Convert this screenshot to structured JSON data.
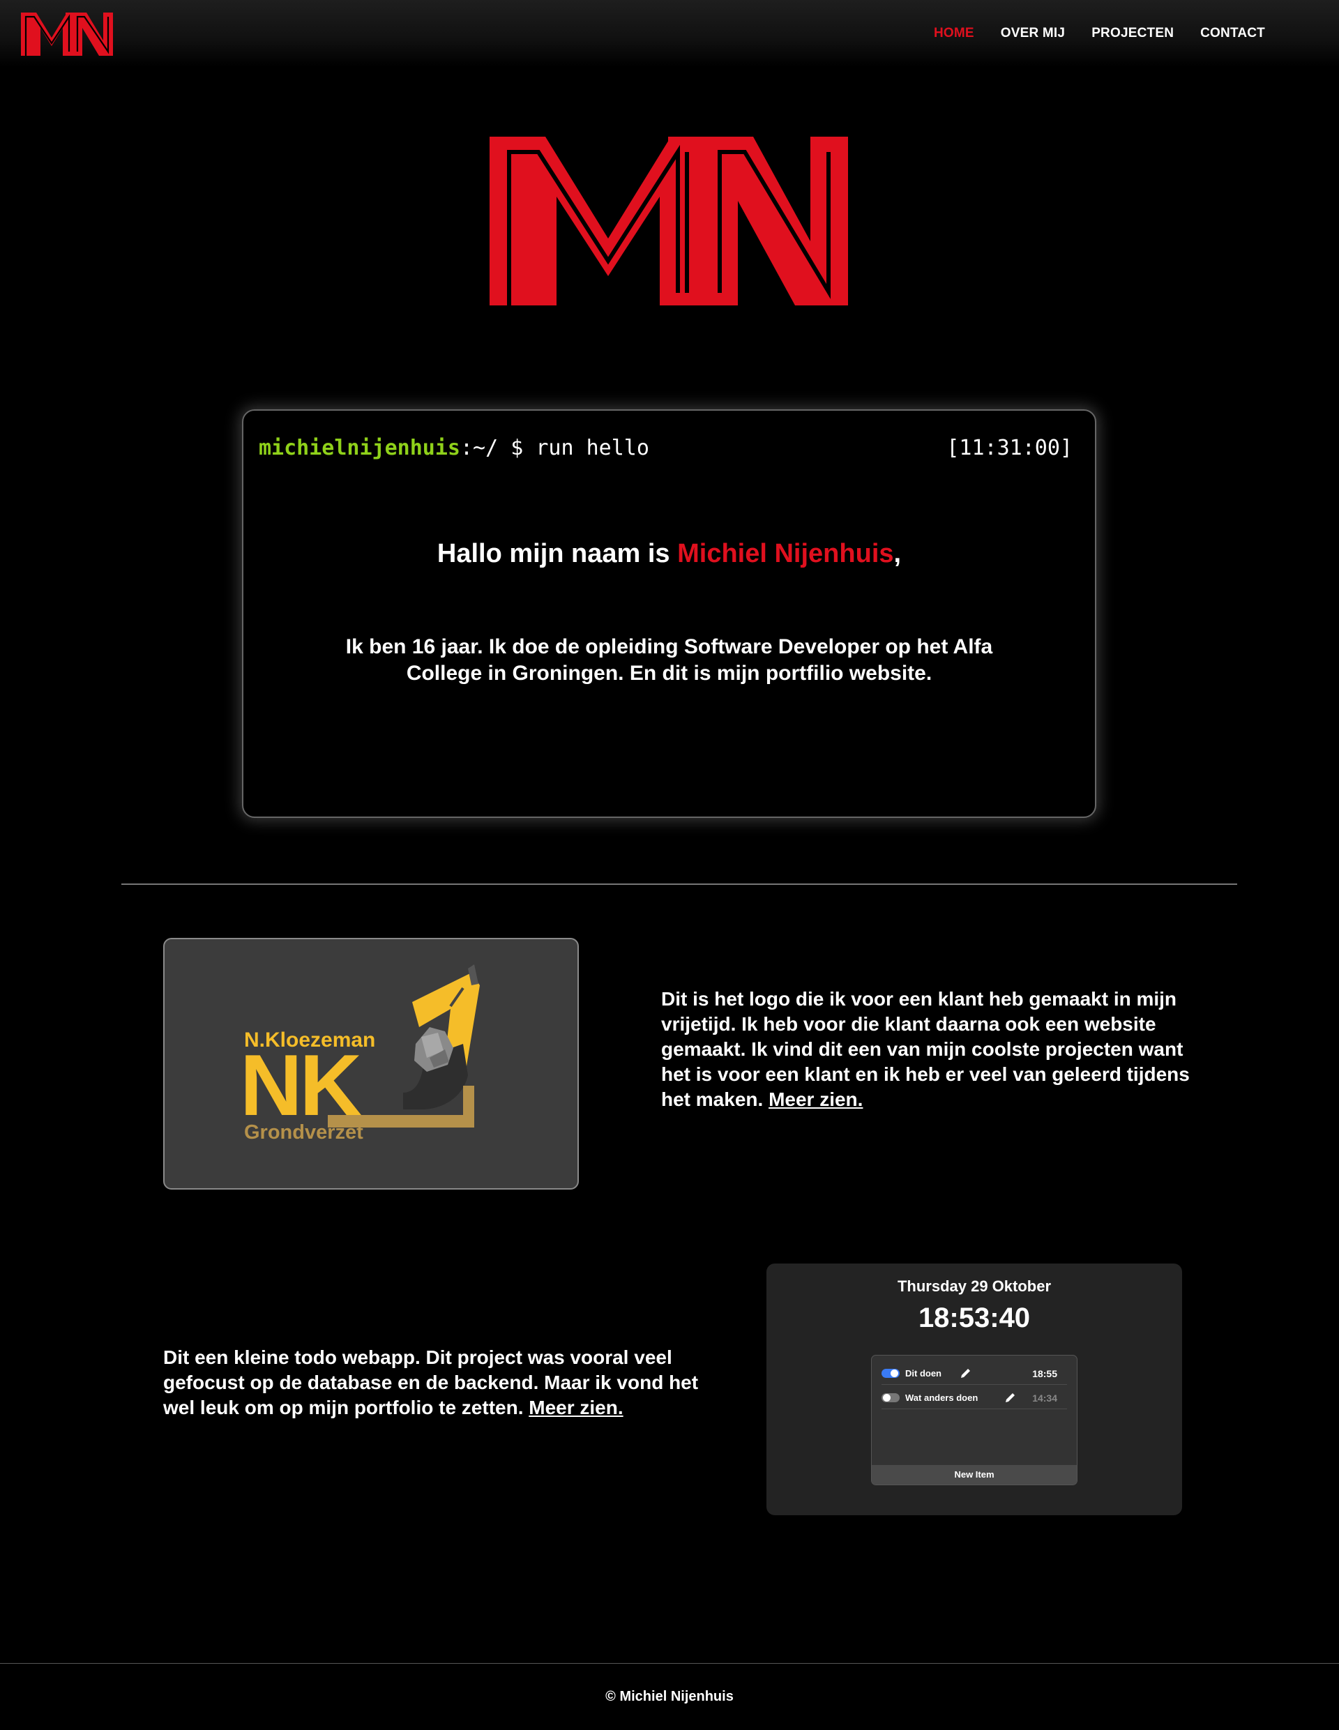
{
  "nav": {
    "logo_alt": "MN",
    "links": [
      {
        "label": "HOME",
        "active": true
      },
      {
        "label": "OVER MIJ",
        "active": false
      },
      {
        "label": "PROJECTEN",
        "active": false
      },
      {
        "label": "CONTACT",
        "active": false
      }
    ]
  },
  "colors": {
    "accent_red": "#e0101e",
    "prompt_green": "#8fd11a",
    "toggle_blue": "#3a7bf5",
    "nk_yellow": "#f5bd29",
    "nk_gold": "#b5914a"
  },
  "terminal": {
    "user": "michielnijenhuis",
    "path": ":~/",
    "command": " $ run hello",
    "time": "[11:31:00]",
    "greeting_prefix": "Hallo mijn naam is ",
    "greeting_name": "Michiel Nijenhuis",
    "greeting_suffix": ",",
    "intro": "Ik ben 16 jaar. Ik doe de opleiding Software Developer op het Alfa College in Groningen. En dit is mijn portfilio website."
  },
  "projects": {
    "p1": {
      "logo": {
        "brand_top": "N.Kloezeman",
        "letters": "NK",
        "brand_bottom": "Grondverzet"
      },
      "text": "Dit is het logo die ik voor een klant heb gemaakt in mijn vrijetijd. Ik heb voor die klant daarna ook een website gemaakt. Ik vind dit een van mijn coolste projecten want het is voor een klant en ik heb er veel van geleerd tijdens het maken. ",
      "link": "Meer zien."
    },
    "p2": {
      "text": "Dit een kleine todo webapp. Dit project was vooral veel gefocust op de database en de backend. Maar ik vond het wel leuk om op mijn portfolio te zetten. ",
      "link": "Meer zien.",
      "todo": {
        "date": "Thursday 29 Oktober",
        "clock": "18:53:40",
        "items": [
          {
            "label": "Dit doen",
            "time": "18:55",
            "done": true
          },
          {
            "label": "Wat anders doen",
            "time": "14:34",
            "done": false
          }
        ],
        "new_item": "New Item"
      }
    }
  },
  "footer": {
    "text": "© Michiel Nijenhuis"
  }
}
